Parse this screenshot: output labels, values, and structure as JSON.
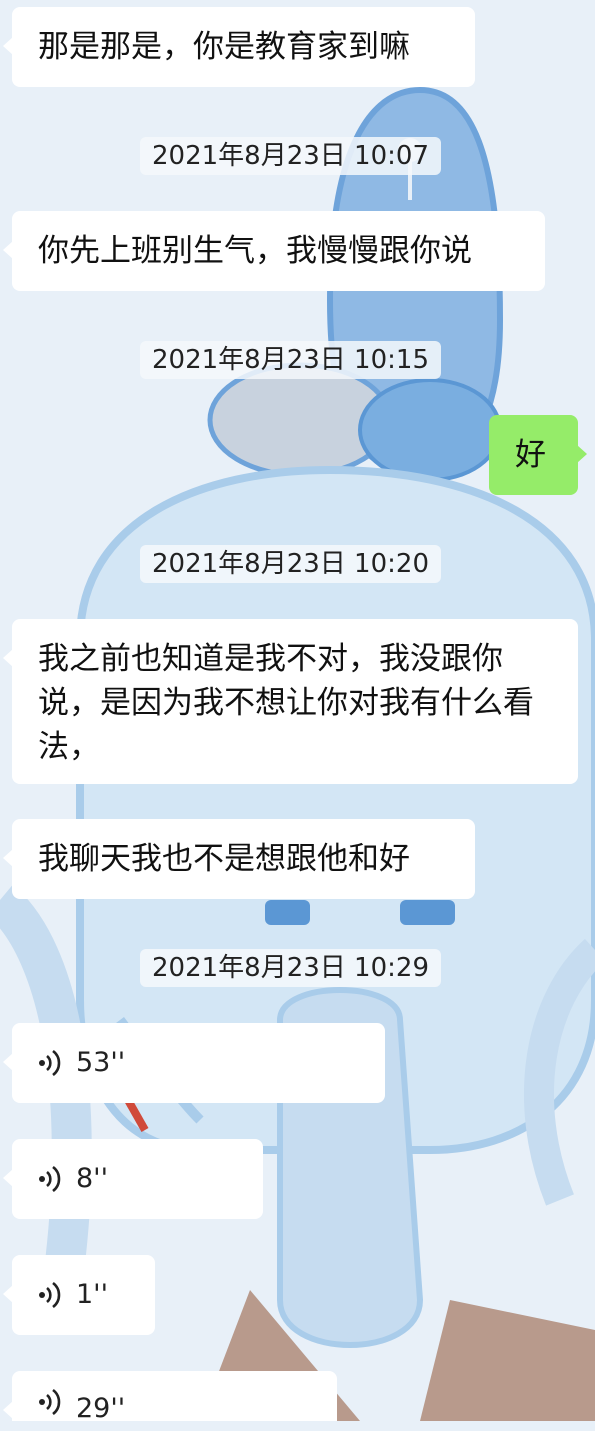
{
  "messages": [
    {
      "type": "text",
      "side": "left",
      "text": "那是那是，你是教育家到嘛"
    },
    {
      "type": "time",
      "text": "2021年8月23日 10:07"
    },
    {
      "type": "text",
      "side": "left",
      "text": "你先上班别生气，我慢慢跟你说"
    },
    {
      "type": "time",
      "text": "2021年8月23日 10:15"
    },
    {
      "type": "text",
      "side": "right",
      "text": "好"
    },
    {
      "type": "time",
      "text": "2021年8月23日 10:20"
    },
    {
      "type": "text",
      "side": "left",
      "text": "我之前也知道是我不对，我没跟你说，是因为我不想让你对我有什么看法，"
    },
    {
      "type": "text",
      "side": "left",
      "text": "我聊天我也不是想跟他和好"
    },
    {
      "type": "time",
      "text": "2021年8月23日 10:29"
    },
    {
      "type": "voice",
      "side": "left",
      "duration": "53''"
    },
    {
      "type": "voice",
      "side": "left",
      "duration": "8''"
    },
    {
      "type": "voice",
      "side": "left",
      "duration": "1''"
    },
    {
      "type": "voice",
      "side": "left",
      "duration": "29''"
    }
  ],
  "colors": {
    "incoming_bubble": "#ffffff",
    "outgoing_bubble": "#95ec69",
    "background": "#e8f0f8"
  },
  "icons": {
    "voice": "voice-wave-icon",
    "background": "cartoon-wallpaper"
  }
}
